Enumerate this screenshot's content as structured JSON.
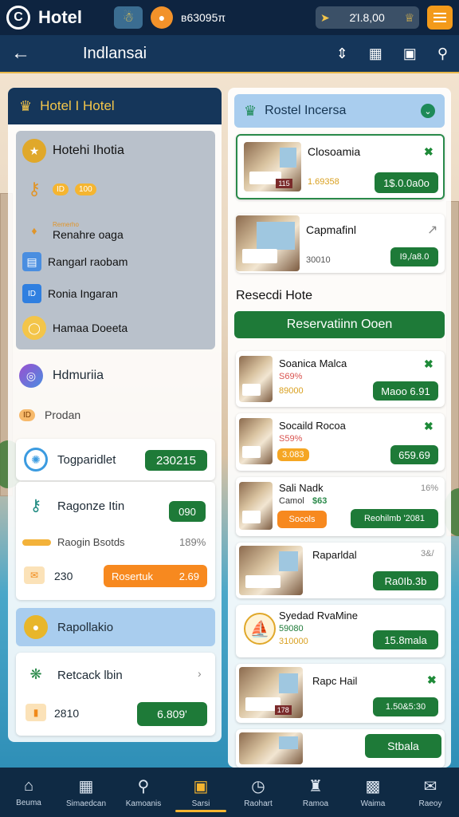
{
  "status": {
    "app_name": "Hotel",
    "status_text": "ʙ63095π",
    "wallet_value": "2Ί.8,00"
  },
  "nav": {
    "title": "Indlansai"
  },
  "left": {
    "header": "Hotel I Hotel",
    "gray_items": [
      {
        "label": "Hotehi Ihotia"
      },
      {
        "tag1": "ID",
        "tag2": "100"
      },
      {
        "small": "Remerho",
        "label": "Renahre oaga"
      },
      {
        "label": "Rangarl raobam"
      },
      {
        "label": "Ronia Ingaran"
      },
      {
        "label": "Hamaa Doeeta"
      }
    ],
    "hdmuria": "Hdmuriia",
    "prodan_tag": "ID",
    "prodan": "Prodan",
    "card1": {
      "label": "Togparidlet",
      "btn": "230215"
    },
    "card2": {
      "label": "Ragonze Itin",
      "btn": "090"
    },
    "progress": {
      "label": "Raogin Bsotds",
      "value": "189%"
    },
    "orange_row": {
      "value": "230",
      "btn": "Rosertuk",
      "btn2": "2.69"
    },
    "blue_card": "Rapollakio",
    "retack": {
      "label": "Retcack lbin"
    },
    "bottom_row": {
      "value": "2810",
      "btn": "6.809'"
    }
  },
  "right": {
    "header": "Rostel Incersa",
    "hotels_top": [
      {
        "name": "Closoamia",
        "sub": "1.69358",
        "btn": "1$.0.0a0o",
        "badge": "115"
      },
      {
        "name": "Capmafinl",
        "sub": "30010",
        "btn": "I9,/a8.0"
      }
    ],
    "section": "Resecdi Hote",
    "reserve_btn": "Reservatiinn Ooen",
    "hotels": [
      {
        "name": "Soanica Malca",
        "sub1": "S69%",
        "sub2": "89000",
        "btn": "Maoo 6.91"
      },
      {
        "name": "Socaild Rocoa",
        "sub1": "S59%",
        "sub2": "3.083",
        "btn": "659.69"
      },
      {
        "name": "Sali Nadk",
        "sub1": "Camol",
        "sub2": "$63",
        "pill": "Socols",
        "btn": "Reohilmb '2081",
        "pct": "16%"
      },
      {
        "name": "Raparldal",
        "sub1": "",
        "sub2": "",
        "btn": "Ra0Ib.3b",
        "pct": "3&/"
      },
      {
        "name": "Syedad RvaMine",
        "sub1": "59080",
        "sub2": "310000",
        "btn": "15.8mala"
      },
      {
        "name": "Rapc Hail",
        "sub1": "",
        "sub2": "",
        "btn": "1.50&5:30"
      },
      {
        "name": "",
        "sub1": "",
        "sub2": "",
        "btn": "Stbala"
      }
    ]
  },
  "tabs": [
    {
      "label": "Beuma",
      "icon": "home-icon"
    },
    {
      "label": "Simaedcan",
      "icon": "calendar-icon"
    },
    {
      "label": "Kamoanis",
      "icon": "user-icon"
    },
    {
      "label": "Sarsi",
      "icon": "hotel-icon"
    },
    {
      "label": "Raohart",
      "icon": "clock-icon"
    },
    {
      "label": "Ramoa",
      "icon": "building-icon"
    },
    {
      "label": "Waima",
      "icon": "chart-icon"
    },
    {
      "label": "Raeoy",
      "icon": "message-icon"
    }
  ]
}
